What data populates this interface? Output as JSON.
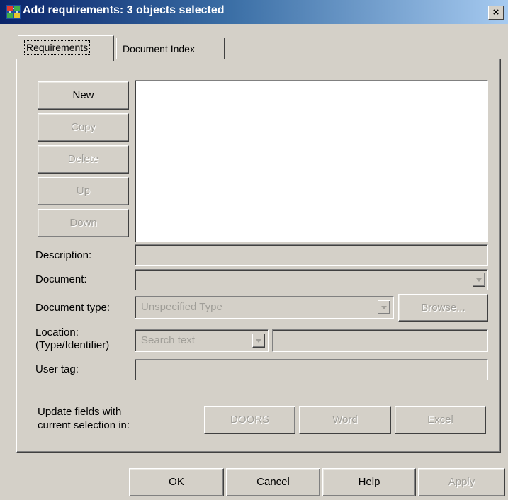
{
  "window": {
    "title": "Add requirements: 3 objects selected",
    "close_label": "×"
  },
  "tabs": [
    {
      "label": "Requirements",
      "active": true
    },
    {
      "label": "Document Index",
      "active": false
    }
  ],
  "side_buttons": {
    "new": "New",
    "copy": "Copy",
    "delete": "Delete",
    "up": "Up",
    "down": "Down"
  },
  "fields": {
    "description_label": "Description:",
    "description_value": "",
    "document_label": "Document:",
    "document_value": "",
    "document_type_label": "Document type:",
    "document_type_value": "Unspecified Type",
    "browse_label": "Browse...",
    "location_label_line1": "Location:",
    "location_label_line2": "(Type/Identifier)",
    "location_type_value": "Search text",
    "location_identifier_value": "",
    "user_tag_label": "User tag:",
    "user_tag_value": ""
  },
  "update": {
    "label_line1": "Update fields with",
    "label_line2": "current selection in:",
    "doors": "DOORS",
    "word": "Word",
    "excel": "Excel"
  },
  "footer": {
    "ok": "OK",
    "cancel": "Cancel",
    "help": "Help",
    "apply": "Apply"
  },
  "icons": {
    "app": "simulink-requirements-icon",
    "dropdown": "chevron-down-icon"
  }
}
